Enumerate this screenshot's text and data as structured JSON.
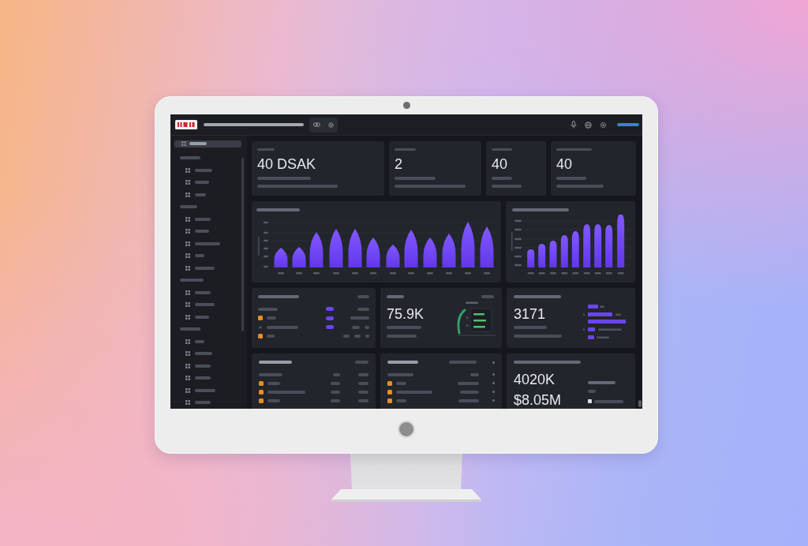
{
  "sidebar": {
    "top_item": {
      "selected": true
    },
    "groups": [
      {
        "items": [
          {
            "selected": false
          },
          {
            "selected": false
          },
          {
            "selected": false
          }
        ]
      },
      {
        "items": [
          {
            "selected": false
          },
          {
            "selected": false
          },
          {
            "selected": false
          },
          {
            "selected": false
          },
          {
            "selected": false
          }
        ]
      },
      {
        "items": [
          {
            "selected": false
          },
          {
            "selected": false
          },
          {
            "selected": false
          }
        ]
      },
      {
        "items": [
          {
            "selected": false
          },
          {
            "selected": false
          },
          {
            "selected": false
          },
          {
            "selected": false
          },
          {
            "selected": false
          },
          {
            "selected": false
          }
        ]
      }
    ]
  },
  "kpi_cards": [
    {
      "value": "40 DSAK"
    },
    {
      "value": "2"
    },
    {
      "value": "40"
    },
    {
      "value": "40"
    }
  ],
  "middle_cards": [
    {
      "kind": "list"
    },
    {
      "kind": "gauge",
      "value": "75.9K"
    },
    {
      "kind": "bars",
      "value": "3171"
    }
  ],
  "bottom_cards": [
    {
      "kind": "table"
    },
    {
      "kind": "table"
    },
    {
      "kind": "stat",
      "value": "4020K",
      "value_2": "$8.05M"
    }
  ]
}
